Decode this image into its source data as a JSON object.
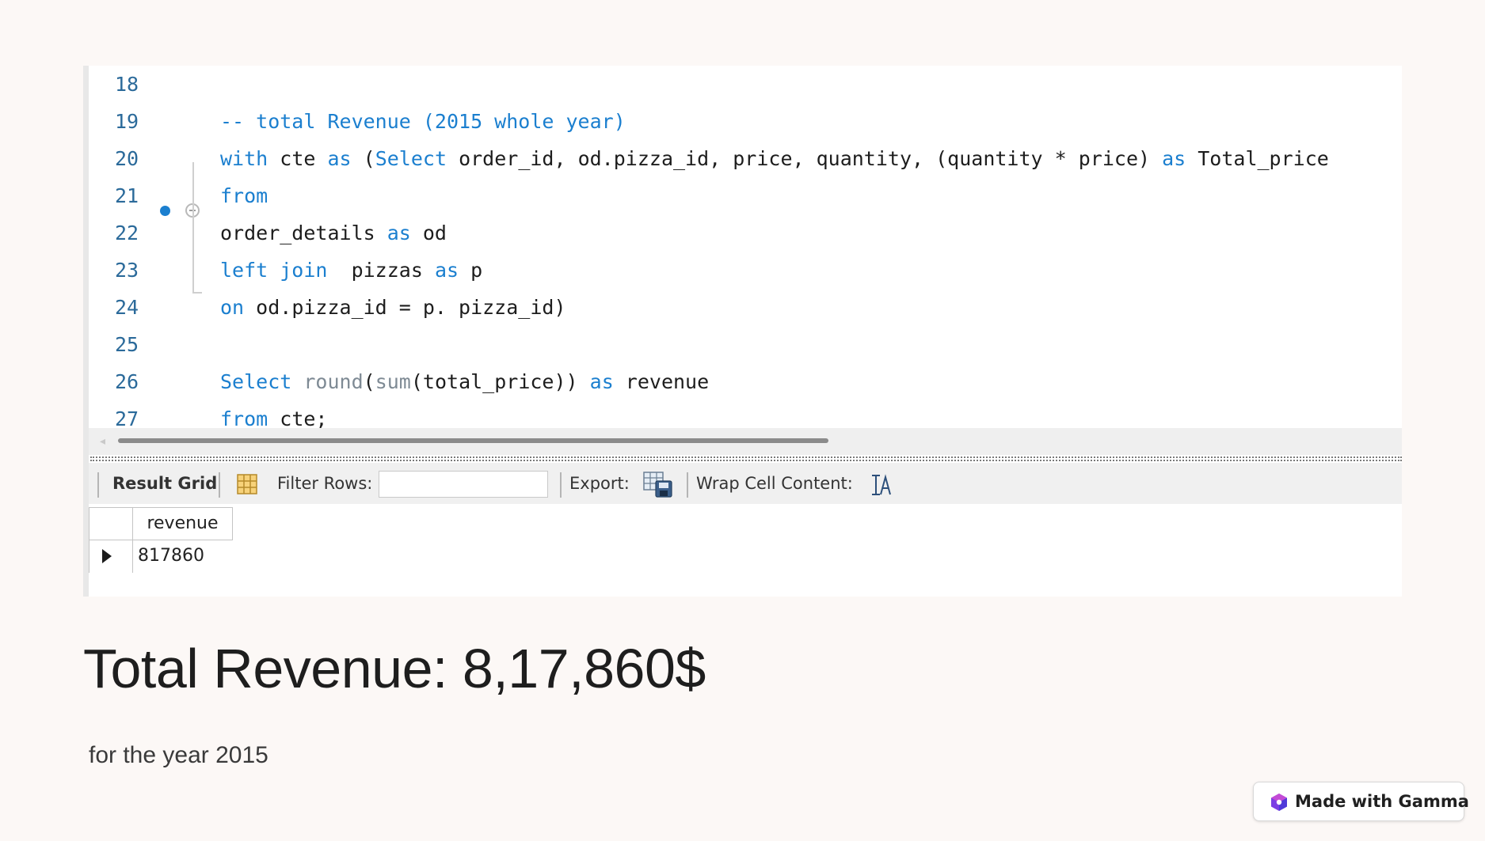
{
  "editor": {
    "lines": [
      {
        "num": "18",
        "parts": []
      },
      {
        "num": "19",
        "parts": [
          {
            "t": "-- total Revenue (2015 whole year)",
            "c": "cm"
          }
        ]
      },
      {
        "num": "20",
        "parts": [
          {
            "t": "with",
            "c": "kw"
          },
          {
            "t": " cte ",
            "c": ""
          },
          {
            "t": "as",
            "c": "kw"
          },
          {
            "t": " (",
            "c": ""
          },
          {
            "t": "Select",
            "c": "kw"
          },
          {
            "t": " order_id, od.pizza_id, price, quantity, (quantity * price) ",
            "c": ""
          },
          {
            "t": "as",
            "c": "kw"
          },
          {
            "t": " Total_price",
            "c": ""
          }
        ]
      },
      {
        "num": "21",
        "parts": [
          {
            "t": "from",
            "c": "kw"
          }
        ]
      },
      {
        "num": "22",
        "parts": [
          {
            "t": "order_details ",
            "c": ""
          },
          {
            "t": "as",
            "c": "kw"
          },
          {
            "t": " od",
            "c": ""
          }
        ]
      },
      {
        "num": "23",
        "parts": [
          {
            "t": "left join",
            "c": "kw"
          },
          {
            "t": "  pizzas ",
            "c": ""
          },
          {
            "t": "as",
            "c": "kw"
          },
          {
            "t": " p",
            "c": ""
          }
        ]
      },
      {
        "num": "24",
        "parts": [
          {
            "t": "on",
            "c": "kw"
          },
          {
            "t": " od.pizza_id = p. pizza_id)",
            "c": ""
          }
        ]
      },
      {
        "num": "25",
        "parts": []
      },
      {
        "num": "26",
        "parts": [
          {
            "t": "Select",
            "c": "kw"
          },
          {
            "t": " ",
            "c": ""
          },
          {
            "t": "round",
            "c": "fn"
          },
          {
            "t": "(",
            "c": ""
          },
          {
            "t": "sum",
            "c": "fn"
          },
          {
            "t": "(total_price)) ",
            "c": ""
          },
          {
            "t": "as",
            "c": "kw"
          },
          {
            "t": " revenue",
            "c": ""
          }
        ]
      },
      {
        "num": "27",
        "parts": [
          {
            "t": "from",
            "c": "kw"
          },
          {
            "t": " cte;",
            "c": ""
          }
        ]
      }
    ]
  },
  "toolbar": {
    "result_grid_label": "Result Grid",
    "filter_rows_label": "Filter Rows:",
    "filter_value": "",
    "export_label": "Export:",
    "wrap_label": "Wrap Cell Content:"
  },
  "result": {
    "columns": [
      "revenue"
    ],
    "rows": [
      [
        "817860"
      ]
    ]
  },
  "slide": {
    "headline": "Total Revenue: 8,17,860$",
    "subtext": "for the year 2015"
  },
  "badge": {
    "label": "Made with Gamma"
  },
  "colors": {
    "keyword": "#1b7fcf",
    "line_number": "#2b6a9a",
    "background": "#fcf8f6"
  }
}
